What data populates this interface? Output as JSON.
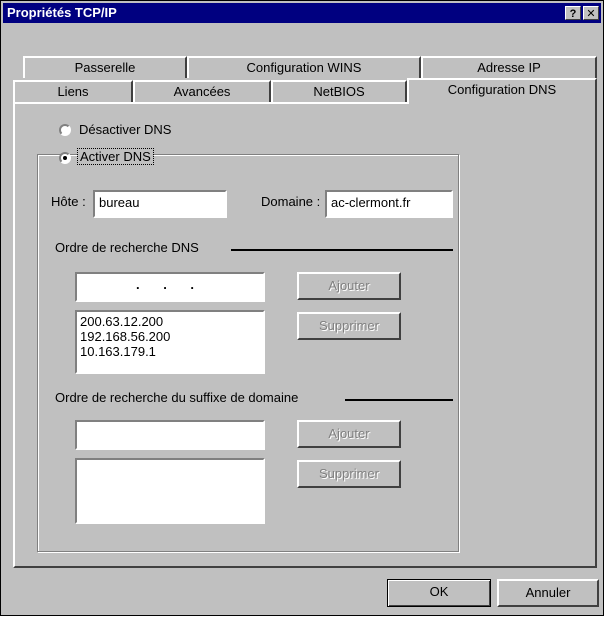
{
  "window": {
    "title": "Propriétés TCP/IP",
    "help_btn": "?",
    "close_btn": "✕"
  },
  "tabs": {
    "row1": [
      "Passerelle",
      "Configuration WINS",
      "Adresse IP"
    ],
    "row2": [
      "Liens",
      "Avancées",
      "NetBIOS",
      "Configuration DNS"
    ]
  },
  "dns": {
    "disable_label": "Désactiver DNS",
    "enable_label": "Activer DNS",
    "host_label": "Hôte :",
    "host_value": "bureau",
    "domain_label": "Domaine :",
    "domain_value": "ac-clermont.fr",
    "search_order_label": "Ordre de recherche DNS",
    "ip_input_value": ". . .",
    "add_label": "Ajouter",
    "remove_label": "Supprimer",
    "servers": [
      "200.63.12.200",
      "192.168.56.200",
      "10.163.179.1"
    ],
    "suffix_order_label": "Ordre de recherche du suffixe de domaine",
    "suffix_input_value": "",
    "suffix_add_label": "Ajouter",
    "suffix_remove_label": "Supprimer"
  },
  "footer": {
    "ok_label": "OK",
    "cancel_label": "Annuler"
  }
}
